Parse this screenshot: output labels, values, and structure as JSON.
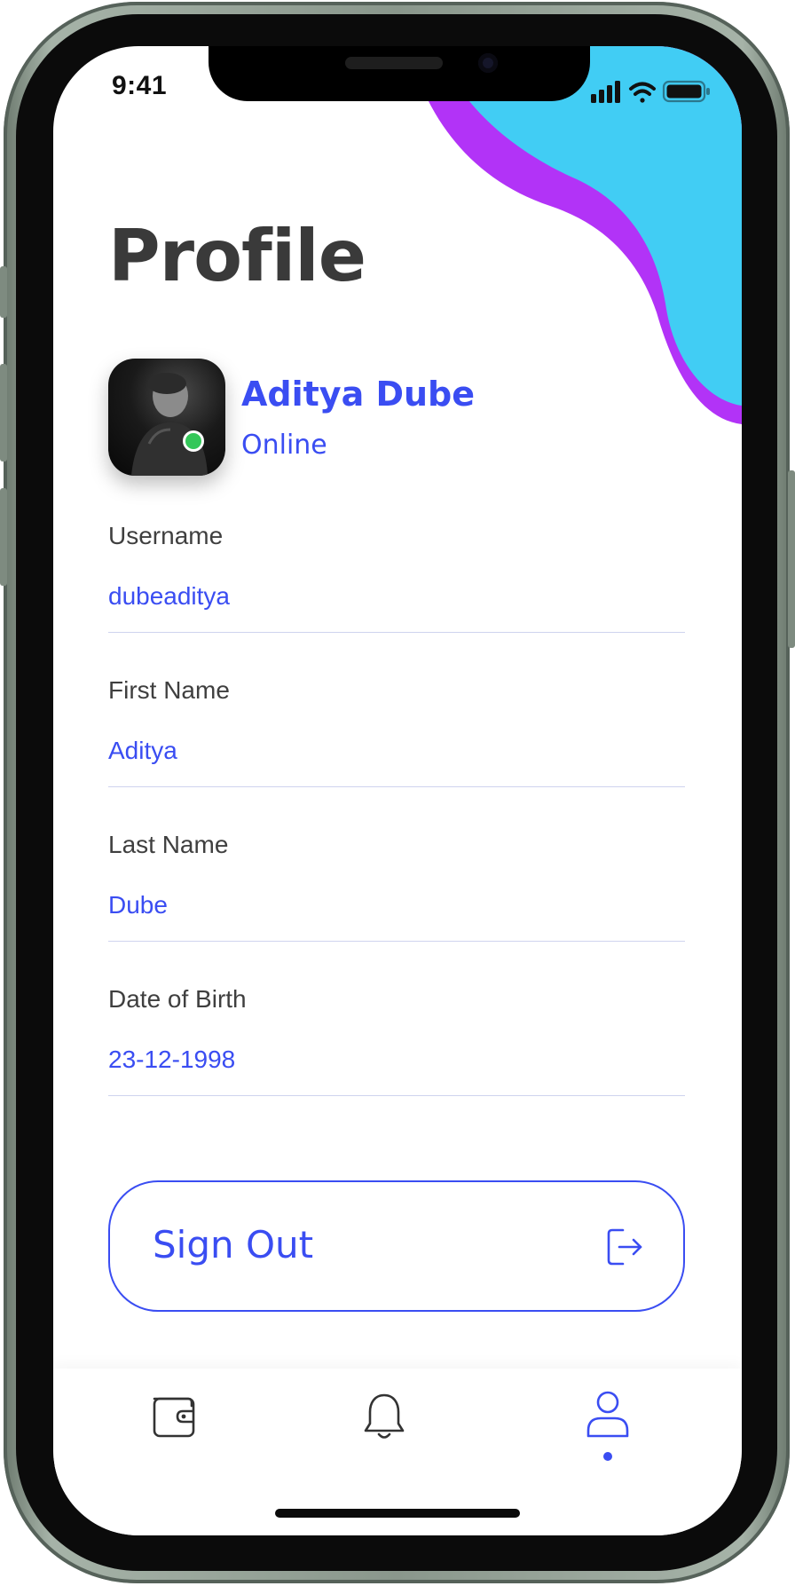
{
  "status_bar": {
    "time": "9:41",
    "icons": [
      "signal-icon",
      "wifi-icon",
      "battery-icon"
    ]
  },
  "header": {
    "title": "Profile"
  },
  "profile": {
    "name": "Aditya Dube",
    "status": "Online"
  },
  "fields": [
    {
      "label": "Username",
      "value": "dubeaditya"
    },
    {
      "label": "First Name",
      "value": "Aditya"
    },
    {
      "label": "Last Name",
      "value": "Dube"
    },
    {
      "label": "Date of Birth",
      "value": "23-12-1998"
    }
  ],
  "actions": {
    "sign_out_label": "Sign Out",
    "sign_out_icon": "logout-icon"
  },
  "tab_bar": {
    "tabs": [
      {
        "id": "wallet",
        "icon": "wallet-icon"
      },
      {
        "id": "notifications",
        "icon": "bell-icon"
      },
      {
        "id": "profile",
        "icon": "user-icon"
      }
    ],
    "active_tab": "profile"
  },
  "colors": {
    "accent": "#3a4df2",
    "blob_cyan": "#41cdf4",
    "blob_purple": "#b233f7",
    "online": "#34c759",
    "title_text": "#3a3a3a"
  }
}
